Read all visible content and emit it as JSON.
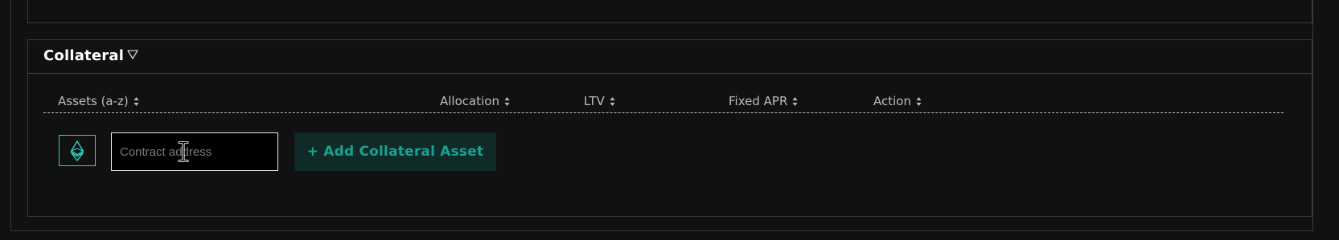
{
  "collateral": {
    "title": "Collateral",
    "toggle_icon": "triangle-down-outline-icon",
    "columns": [
      {
        "label": "Assets (a-z)",
        "sort_icon": "sort-updown-icon"
      },
      {
        "label": "Allocation",
        "sort_icon": "sort-updown-icon"
      },
      {
        "label": "LTV",
        "sort_icon": "sort-updown-icon"
      },
      {
        "label": "Fixed APR",
        "sort_icon": "sort-updown-icon"
      },
      {
        "label": "Action",
        "sort_icon": "sort-updown-icon"
      }
    ],
    "asset_icon": "ethereum-icon",
    "contract_input": {
      "value": "",
      "placeholder": "Contract address"
    },
    "add_button_label": "+ Add Collateral Asset"
  },
  "colors": {
    "background": "#111111",
    "border": "#3a3a3a",
    "accent": "#2fd2c7",
    "button_bg": "#0f2a27",
    "button_text": "#18a28f",
    "header_text": "#bdbdbd"
  }
}
